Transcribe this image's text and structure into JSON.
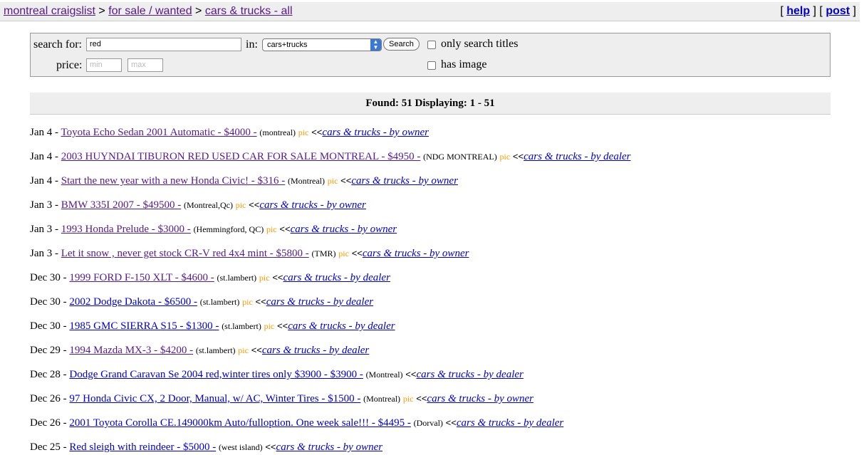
{
  "header": {
    "crumbs": [
      "montreal craigslist",
      "for sale / wanted",
      "cars & trucks - all"
    ],
    "sep": ">",
    "links": [
      "help",
      "post"
    ]
  },
  "search": {
    "search_for_label": "search for:",
    "query": "red",
    "in_label": "in:",
    "category": "cars+trucks",
    "button": "Search",
    "titles_only_label": "only search titles",
    "has_image_label": "has image",
    "price_label": "price:",
    "min_placeholder": "min",
    "max_placeholder": "max"
  },
  "found": "Found: 51 Displaying: 1 - 51",
  "listings": [
    {
      "date": "Jan 4",
      "title": "Toyota Echo Sedan 2001 Automatic - $4000 -",
      "loc": "(montreal)",
      "pic": "pic",
      "cat": "cars & trucks - by owner",
      "visited": true
    },
    {
      "date": "Jan 4",
      "title": "2003 HUYNDAI TIBURON RED USED CAR FOR SALE MONTREAL - $4950 -",
      "loc": "(NDG MONTREAL)",
      "pic": "pic",
      "cat": "cars & trucks - by dealer",
      "visited": true
    },
    {
      "date": "Jan 4",
      "title": "Start the new year with a new Honda Civic! - $316 -",
      "loc": "(Montreal)",
      "pic": "pic",
      "cat": "cars & trucks - by owner",
      "visited": true
    },
    {
      "date": "Jan 3",
      "title": "BMW 335I 2007 - $49500 -",
      "loc": "(Montreal,Qc)",
      "pic": "pic",
      "cat": "cars & trucks - by owner",
      "visited": true
    },
    {
      "date": "Jan 3",
      "title": "1993 Honda Prelude - $3000 -",
      "loc": "(Hemmingford, QC)",
      "pic": "pic",
      "cat": "cars & trucks - by owner",
      "visited": true
    },
    {
      "date": "Jan 3",
      "title": "Let it snow , never get stock CR-V red 4x4 mint - $5800 -",
      "loc": "(TMR)",
      "pic": "pic",
      "cat": "cars & trucks - by owner",
      "visited": true
    },
    {
      "date": "Dec 30",
      "title": "1999 FORD F-150 XLT - $4600 -",
      "loc": "(st.lambert)",
      "pic": "pic",
      "cat": "cars & trucks - by dealer",
      "visited": true
    },
    {
      "date": "Dec 30",
      "title": "2002 Dodge Dakota - $6500 -",
      "loc": "(st.lambert)",
      "pic": "pic",
      "cat": "cars & trucks - by dealer",
      "visited": false
    },
    {
      "date": "Dec 30",
      "title": "1985 GMC SIERRA  S15 - $1300 -",
      "loc": "(st.lambert)",
      "pic": "pic",
      "cat": "cars & trucks - by dealer",
      "visited": false
    },
    {
      "date": "Dec 29",
      "title": "1994 Mazda MX-3 - $4200 -",
      "loc": "(st.lambert)",
      "pic": "pic",
      "cat": "cars & trucks - by dealer",
      "visited": true
    },
    {
      "date": "Dec 28",
      "title": "Dodge Grand Caravan Se 2004 red,winter tires only $3900 - $3900 -",
      "loc": "(Montreal)",
      "pic": "",
      "cat": "cars & trucks - by dealer",
      "visited": false
    },
    {
      "date": "Dec 26",
      "title": "97 Honda Civic CX, 2 Door, Manual, w/ AC, Winter Tires - $1500 -",
      "loc": "(Montreal)",
      "pic": "pic",
      "cat": "cars & trucks - by owner",
      "visited": false
    },
    {
      "date": "Dec 26",
      "title": "2001 Toyota Corolla CE.149000km Auto/fulloption. One week sale!!! - $4495 -",
      "loc": "(Dorval)",
      "pic": "",
      "cat": "cars & trucks - by dealer",
      "visited": false
    },
    {
      "date": "Dec 25",
      "title": "Red sleigh with reindeer - $5000 -",
      "loc": "(west island)",
      "pic": "",
      "cat": "cars & trucks - by owner",
      "visited": false
    }
  ],
  "colors": {
    "link": "#0000cc",
    "visited": "#551a8b",
    "pic": "#ff9900",
    "bar": "#eeeeee"
  }
}
